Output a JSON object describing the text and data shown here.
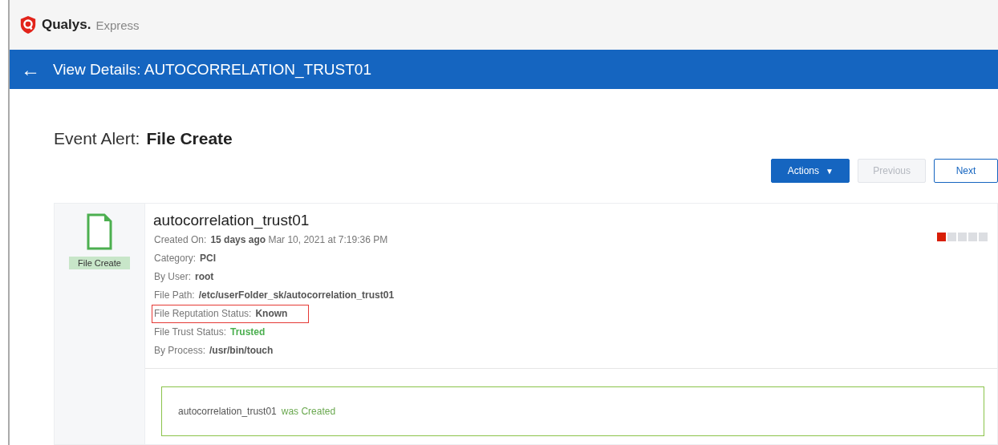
{
  "header": {
    "brand": "Qualys.",
    "product": "Express"
  },
  "title_bar": {
    "back": "←",
    "title": "View Details: AUTOCORRELATION_TRUST01"
  },
  "page": {
    "label": "Event Alert:",
    "value": "File Create"
  },
  "buttons": [
    {
      "label": "Actions",
      "caret": "▼",
      "kind": "primary",
      "disabled": false
    },
    {
      "label": "Previous",
      "kind": "secondary",
      "disabled": true
    },
    {
      "label": "Next",
      "kind": "secondary",
      "disabled": false
    }
  ],
  "event": {
    "type_label": "File Create",
    "name": "autocorrelation_trust01",
    "severity": {
      "level": 0.2
    },
    "details": [
      {
        "label": "Created On:",
        "value": "**15 days ago** Mar 10, 2021 at 7:19:36 PM",
        "kind": "mixed",
        "highlighted": false
      },
      {
        "label": "Category:",
        "value": "PCI",
        "kind": "strong",
        "highlighted": false
      },
      {
        "label": "By User:",
        "value": "root",
        "kind": "strong",
        "highlighted": false
      },
      {
        "label": "File Path:",
        "value": "/etc/userFolder_sk/autocorrelation_trust01",
        "kind": "strong",
        "highlighted": false
      },
      {
        "label": "File Reputation Status:",
        "value": "Known",
        "kind": "strong",
        "highlighted": true
      },
      {
        "label": "File Trust Status:",
        "value": "Trusted",
        "kind": "success",
        "highlighted": false
      },
      {
        "label": "By Process:",
        "value": "/usr/bin/touch",
        "kind": "strong",
        "highlighted": false
      }
    ],
    "message": {
      "subject": "autocorrelation_trust01",
      "action": "was Created"
    }
  }
}
